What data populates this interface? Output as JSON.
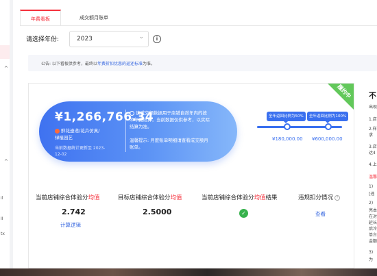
{
  "sidebar": {
    "carets": [
      "^",
      "^"
    ],
    "texts": [
      "il",
      "II",
      "tx"
    ]
  },
  "tabs": [
    {
      "label": "年费看板",
      "active": true
    },
    {
      "label": "成交额月账单",
      "active": false
    }
  ],
  "year_filter": {
    "label": "请选择年份:",
    "value": "2023"
  },
  "notice": {
    "prefix": "公告: 以下看板供参考，最终以",
    "link": "年费折扣优惠的返还标准",
    "suffix": "为准。"
  },
  "card": {
    "badge": "履约中",
    "amount": "¥1,266,766.34",
    "shop_name": "鲜花速递/花卉仿真/绿植园艺",
    "update_note": "当前数据统计更新至 2023-12-02",
    "description": "该成交额数据用于店铺自然年内的技术年费结算，当前数据仅供参考，以实际结算为准。",
    "tip": "温馨提示: 月度账单明细请查看成交额月账单。",
    "slider": {
      "bubbles": [
        "全年返回比例为50%",
        "全年返回比例为100%"
      ],
      "thresholds": [
        "¥180,000.00",
        "¥600,000.00"
      ],
      "progress": 1.0
    },
    "metrics": [
      {
        "head_pre": "当前店铺综合体验分",
        "head_red": "均值",
        "head_post": "",
        "value": "2.742",
        "link": "计算逻辑"
      },
      {
        "head_pre": "目标店铺综合体验分",
        "head_red": "均值",
        "head_post": "",
        "value": "2.5000",
        "link": ""
      },
      {
        "head_pre": "当前店铺综合体验分",
        "head_red": "均值",
        "head_post": "结果",
        "value": "",
        "link": ""
      },
      {
        "head_pre": "违规扣分情况",
        "head_red": "",
        "head_post": "",
        "value": "",
        "link": "查看"
      }
    ]
  },
  "right_panel": {
    "title": "不",
    "lines": [
      "出现",
      "1.店",
      "2.样",
      "求",
      "3.店",
      "达4",
      "4.上",
      "温馨",
      "1)",
      "[违",
      "2)",
      "亮本",
      "在对",
      "延长",
      "后冷",
      "单台",
      "金额",
      "3)",
      "为"
    ]
  },
  "colors": {
    "accent_red": "#f5313d",
    "accent_blue": "#3a70ef",
    "badge_green": "#62c85a",
    "ok_green": "#37b24d"
  }
}
